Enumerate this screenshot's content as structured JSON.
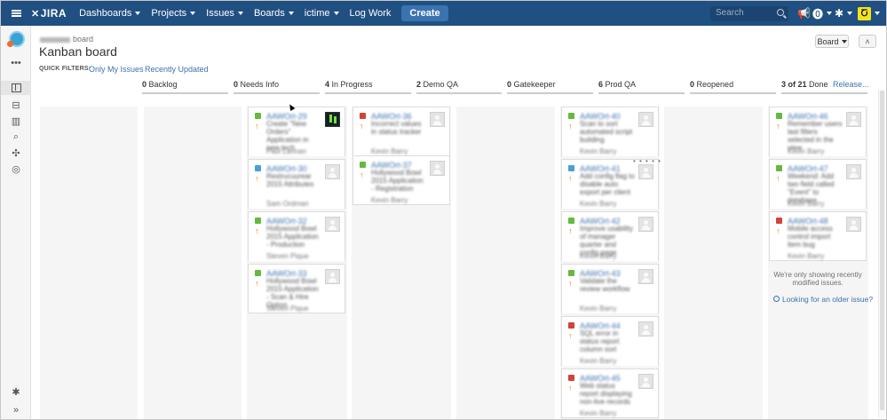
{
  "topnav": {
    "logo": "JIRA",
    "items": [
      "Dashboards",
      "Projects",
      "Issues",
      "Boards"
    ],
    "ictime": "ictime",
    "log_work": "Log Work",
    "create": "Create",
    "search_placeholder": "Search"
  },
  "sidebar": {
    "more": "•••",
    "collapse": "»"
  },
  "header": {
    "context": "board",
    "title": "Kanban board",
    "board_button": "Board",
    "collapse_button": "˄"
  },
  "quick_filters": {
    "label": "QUICK FILTERS:",
    "only_my_issues": "Only My Issues",
    "recently_updated": "Recently Updated"
  },
  "columns": [
    {
      "count": "0",
      "name": "Backlog"
    },
    {
      "count": "0",
      "name": "Needs Info"
    },
    {
      "count": "4",
      "name": "In Progress"
    },
    {
      "count": "2",
      "name": "Demo QA"
    },
    {
      "count": "0",
      "name": "Gatekeeper"
    },
    {
      "count": "6",
      "name": "Prod QA"
    },
    {
      "count": "0",
      "name": "Reopened"
    },
    {
      "count": "3 of 21",
      "name": "Done"
    }
  ],
  "release_link": "Release...",
  "cards": {
    "in_progress": [
      {
        "type": "story",
        "key": "AAWOrt-29",
        "summary": "Create \"New Orders\" Application in new tech",
        "assignee": "Paul Lannan",
        "avatar": "photo"
      },
      {
        "type": "check",
        "key": "AAWOrt-30",
        "summary": "Restrucuurear 2015 Attributes",
        "assignee": "Sam Ordman",
        "avatar": "default"
      },
      {
        "type": "story",
        "key": "AAWOrt-32",
        "summary": "Hollywood Bowl 2015 Application - Production",
        "assignee": "Steven Pique",
        "avatar": "default"
      },
      {
        "type": "story",
        "key": "AAWOrt-33",
        "summary": "Hollywood Bowl 2015 Application - Scan & Hire Option",
        "assignee": "Steven Pique",
        "avatar": "default"
      }
    ],
    "demo_qa": [
      {
        "type": "bug",
        "key": "AAWOrt-36",
        "summary": "Incorrect values in status tracker",
        "assignee": "Kevin Barry",
        "avatar": "default"
      },
      {
        "type": "story",
        "key": "AAWOrt-37",
        "summary": "Hollywood Bowl 2015 Application - Registration",
        "assignee": "Kevin Barry",
        "avatar": "default"
      }
    ],
    "prod_qa": [
      {
        "type": "story",
        "key": "AAWOrt-40",
        "summary": "Scan to sort automated script building",
        "assignee": "Kevin Barry",
        "avatar": "default"
      },
      {
        "type": "task",
        "key": "AAWOrt-41",
        "summary": "Add config flag to disable auto export per client",
        "assignee": "Kevin Barry",
        "avatar": "default"
      },
      {
        "type": "story",
        "key": "AAWOrt-42",
        "summary": "Improve usability of manager quarter and config page",
        "assignee": "Kevin Barry",
        "avatar": "default"
      },
      {
        "type": "story",
        "key": "AAWOrt-43",
        "summary": "Validate the review workflow",
        "assignee": "Kevin Barry",
        "avatar": "default"
      },
      {
        "type": "bug",
        "key": "AAWOrt-44",
        "summary": "SQL error in status report column sort",
        "assignee": "Kevin Barry",
        "avatar": "default"
      },
      {
        "type": "bug",
        "key": "AAWOrt-45",
        "summary": "Web status report displaying non-live records",
        "assignee": "Kevin Barry",
        "avatar": "default"
      }
    ],
    "done": [
      {
        "type": "story",
        "key": "AAWOrt-46",
        "summary": "Remember users last filters selected in the view",
        "assignee": "Kevin Barry",
        "avatar": "default"
      },
      {
        "type": "story",
        "key": "AAWOrt-47",
        "summary": "Weekend: Add two field called \"Event\" to database",
        "assignee": "Kevin Barry",
        "avatar": "default"
      },
      {
        "type": "bug",
        "key": "AAWOrt-48",
        "summary": "Mobile access control import item bug",
        "assignee": "Kevin Barry",
        "avatar": "default"
      }
    ]
  },
  "done_note": "We're only showing recently modified issues.",
  "older_link": "Looking for an older issue?"
}
